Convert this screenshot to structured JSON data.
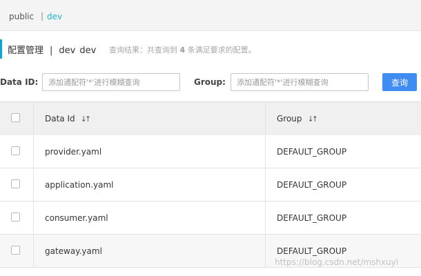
{
  "namespace_bar": {
    "items": [
      {
        "label": "public"
      },
      {
        "label": "dev"
      }
    ],
    "separator": "|"
  },
  "page_header": {
    "title": "配置管理",
    "separator": "|",
    "env_id": "dev",
    "env_name": "dev",
    "result_prefix": "查询结果：共查询到",
    "result_count": "4",
    "result_suffix": "条满足要求的配置。"
  },
  "search": {
    "data_id_label": "Data ID:",
    "data_id_placeholder": "添加通配符'*'进行模糊查询",
    "group_label": "Group:",
    "group_placeholder": "添加通配符'*'进行模糊查询",
    "query_button": "查询"
  },
  "table": {
    "columns": [
      {
        "label": "Data Id",
        "sort_icon": "↓↑"
      },
      {
        "label": "Group",
        "sort_icon": "↓↑"
      }
    ],
    "rows": [
      {
        "data_id": "provider.yaml",
        "group": "DEFAULT_GROUP"
      },
      {
        "data_id": "application.yaml",
        "group": "DEFAULT_GROUP"
      },
      {
        "data_id": "consumer.yaml",
        "group": "DEFAULT_GROUP"
      },
      {
        "data_id": "gateway.yaml",
        "group": "DEFAULT_GROUP"
      }
    ]
  },
  "watermark": "https://blog.csdn.net/mshxuyi",
  "colors": {
    "accent": "#0fa5d6",
    "active_namespace": "#1fb3d4",
    "primary_button": "#3f8cf3"
  }
}
